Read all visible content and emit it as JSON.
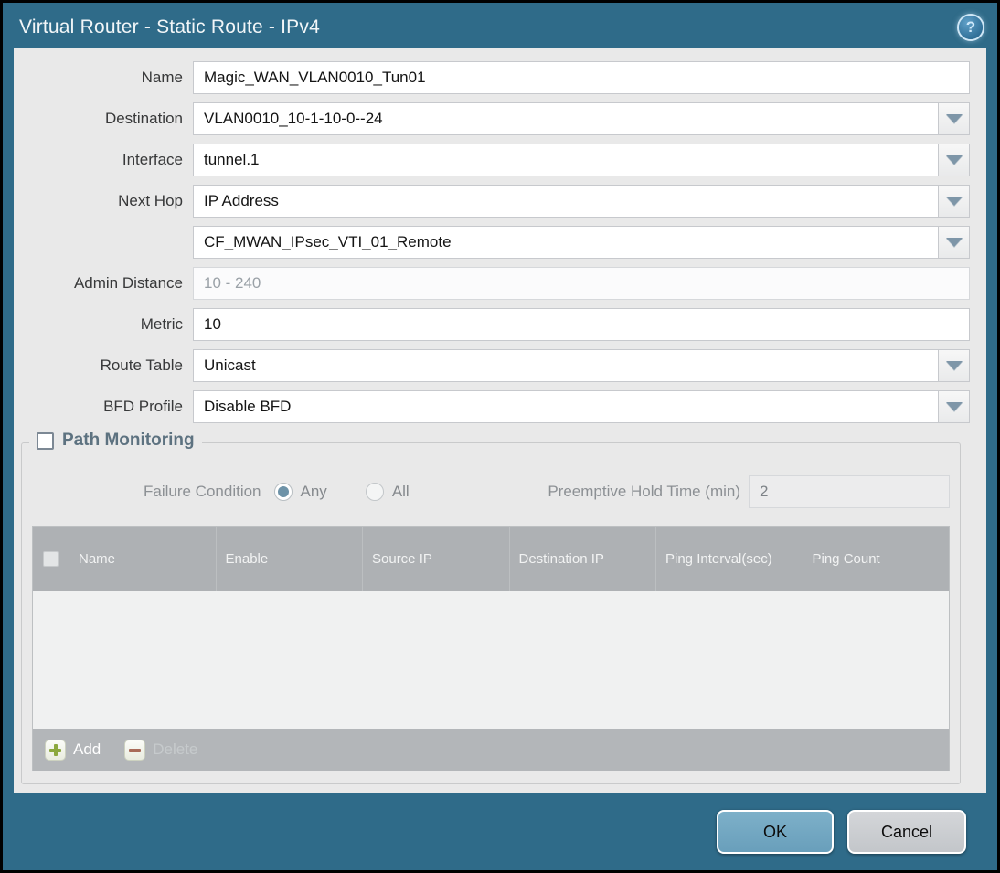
{
  "titlebar": {
    "title": "Virtual Router - Static Route - IPv4",
    "help_glyph": "?"
  },
  "form": {
    "name": {
      "label": "Name",
      "value": "Magic_WAN_VLAN0010_Tun01"
    },
    "destination": {
      "label": "Destination",
      "value": "VLAN0010_10-1-10-0--24"
    },
    "interface": {
      "label": "Interface",
      "value": "tunnel.1"
    },
    "next_hop": {
      "label": "Next Hop",
      "type_value": "IP Address",
      "address_value": "CF_MWAN_IPsec_VTI_01_Remote"
    },
    "admin_distance": {
      "label": "Admin Distance",
      "placeholder": "10 - 240"
    },
    "metric": {
      "label": "Metric",
      "value": "10"
    },
    "route_table": {
      "label": "Route Table",
      "value": "Unicast"
    },
    "bfd_profile": {
      "label": "BFD Profile",
      "value": "Disable BFD"
    }
  },
  "path_monitoring": {
    "title": "Path Monitoring",
    "checked": false,
    "failure_condition_label": "Failure Condition",
    "radio_any_label": "Any",
    "radio_all_label": "All",
    "selected_failure_condition": "Any",
    "preemptive_label": "Preemptive Hold Time (min)",
    "preemptive_value": "2",
    "table": {
      "columns": [
        "Name",
        "Enable",
        "Source IP",
        "Destination IP",
        "Ping Interval(sec)",
        "Ping Count"
      ],
      "rows": []
    },
    "add_label": "Add",
    "delete_label": "Delete"
  },
  "footer": {
    "ok_label": "OK",
    "cancel_label": "Cancel"
  },
  "colors": {
    "frame_teal": "#2f6b89",
    "content_bg": "#e9e9e9",
    "table_header_bg": "#aeb1b4",
    "ok_button_bg": "#6fa6c1",
    "cancel_button_bg": "#c9ccd0",
    "add_icon_green": "#8ca83e",
    "delete_icon_red": "#a96b58",
    "dropdown_arrow": "#7e96a8",
    "pm_title_text": "#5d7280"
  }
}
